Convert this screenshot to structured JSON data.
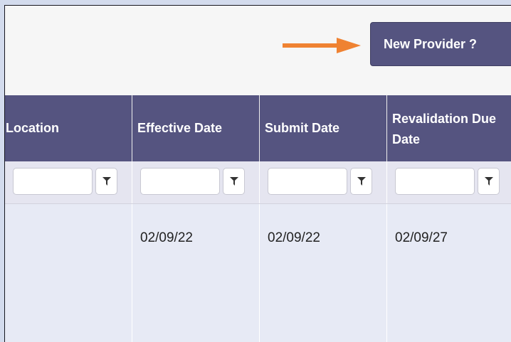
{
  "toolbar": {
    "new_provider_label": "New Provider ?"
  },
  "icons": {
    "arrow": "right-arrow-icon",
    "filter": "filter-funnel-icon"
  },
  "colors": {
    "header_bg": "#555480",
    "arrow": "#ef8232",
    "filter_row_bg": "#e5e5f0",
    "data_row_bg": "#e7eaf5"
  },
  "table": {
    "columns": [
      {
        "label": "Location"
      },
      {
        "label": "Effective Date"
      },
      {
        "label": "Submit Date"
      },
      {
        "label": "Revalidation Due Date"
      }
    ],
    "rows": [
      {
        "location": "",
        "effective_date": "02/09/22",
        "submit_date": "02/09/22",
        "revalidation_due_date": "02/09/27"
      }
    ]
  }
}
